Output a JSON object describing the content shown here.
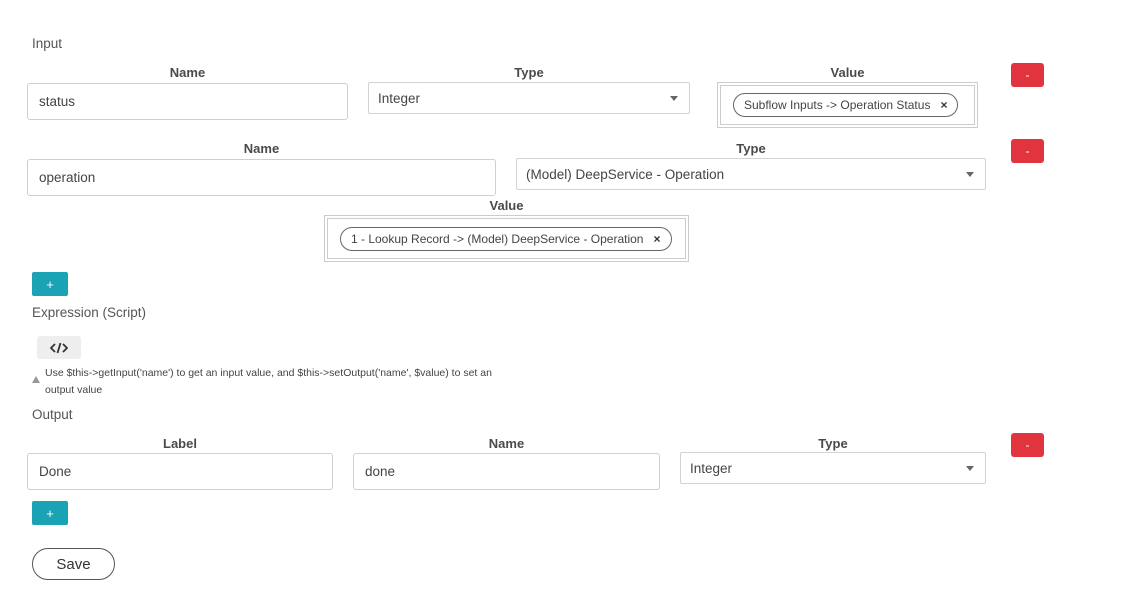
{
  "input": {
    "section_label": "Input",
    "rows": [
      {
        "name_header": "Name",
        "type_header": "Type",
        "value_header": "Value",
        "name_value": "status",
        "type_value": "Integer",
        "value_tag": "Subflow Inputs -> Operation Status",
        "remove_label": "-"
      },
      {
        "name_header": "Name",
        "type_header": "Type",
        "value_header": "Value",
        "name_value": "operation",
        "type_value": "(Model) DeepService - Operation",
        "value_tag": "1 - Lookup Record -> (Model) DeepService - Operation",
        "remove_label": "-"
      }
    ],
    "add_label": "+"
  },
  "expression": {
    "section_label": "Expression (Script)",
    "code_icon_glyph": "</>",
    "hint_line1": "Use $this->getInput('name') to get an input value, and $this->setOutput('name', $value) to set an",
    "hint_line2": "output value"
  },
  "output": {
    "section_label": "Output",
    "label_header": "Label",
    "name_header": "Name",
    "type_header": "Type",
    "label_value": "Done",
    "name_value": "done",
    "type_value": "Integer",
    "remove_label": "-",
    "add_label": "+"
  },
  "save_label": "Save",
  "tag_remove_glyph": "×",
  "colors": {
    "danger": "#e2343f",
    "accent": "#1aa3b5"
  }
}
